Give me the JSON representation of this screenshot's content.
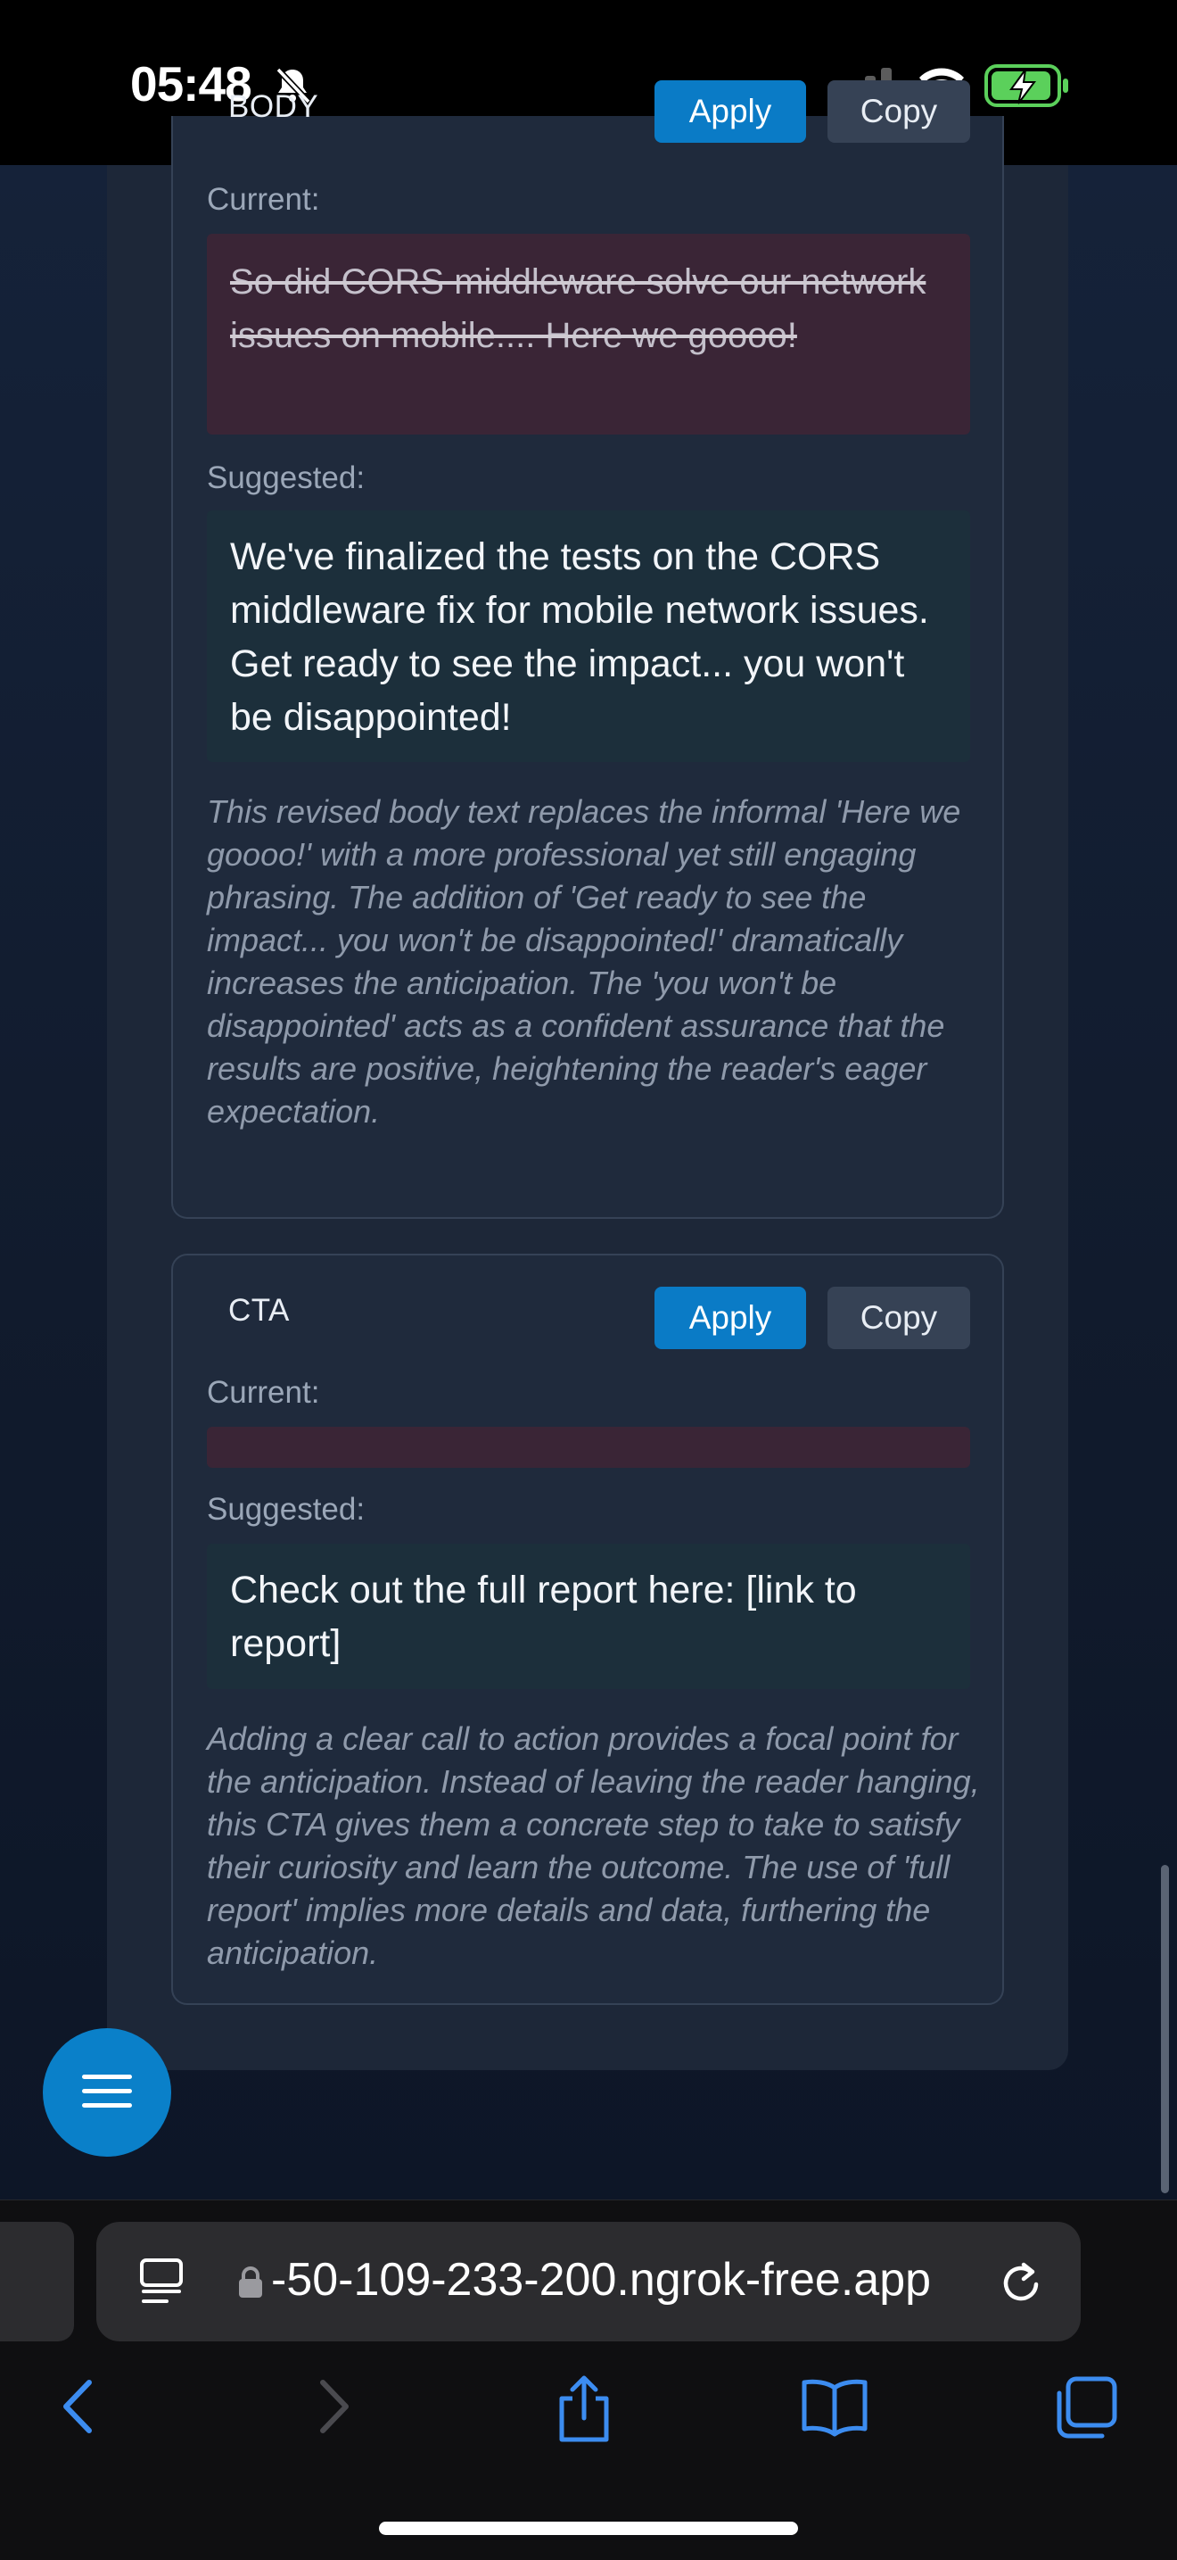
{
  "status_bar": {
    "time": "05:48"
  },
  "body_section": {
    "title": "BODY",
    "apply_label": "Apply",
    "copy_label": "Copy",
    "current_label": "Current:",
    "current_text": "So did CORS middleware solve our network issues on mobile.... Here we goooo!",
    "suggested_label": "Suggested:",
    "suggested_text": "We've finalized the tests on the CORS middleware fix for mobile network issues. Get ready to see the impact... you won't be disappointed!",
    "explanation": "This revised body text replaces the informal 'Here we goooo!' with a more professional yet still engaging phrasing. The addition of 'Get ready to see the impact... you won't be disappointed!' dramatically increases the anticipation. The 'you won't be disappointed' acts as a confident assurance that the results are positive, heightening the reader's eager expectation."
  },
  "cta_section": {
    "title": "CTA",
    "apply_label": "Apply",
    "copy_label": "Copy",
    "current_label": "Current:",
    "current_text": "",
    "suggested_label": "Suggested:",
    "suggested_text": "Check out the full report here: [link to report]",
    "explanation": "Adding a clear call to action provides a focal point for the anticipation. Instead of leaving the reader hanging, this CTA gives them a concrete step to take to satisfy their curiosity and learn the outcome. The use of 'full report' implies more details and data, furthering the anticipation."
  },
  "browser": {
    "url": "-50-109-233-200.ngrok-free.app"
  },
  "icons": {
    "menu": "hamburger-menu-icon",
    "reader": "reader-mode-icon",
    "lock": "lock-icon",
    "reload": "reload-icon",
    "back": "chevron-left-icon",
    "forward": "chevron-right-icon",
    "share": "share-icon",
    "bookmarks": "book-icon",
    "tabs": "tabs-icon"
  },
  "colors": {
    "accent": "#0a7bc6",
    "current_bg": "#3a2536",
    "suggested_bg": "#1c2f3b"
  }
}
